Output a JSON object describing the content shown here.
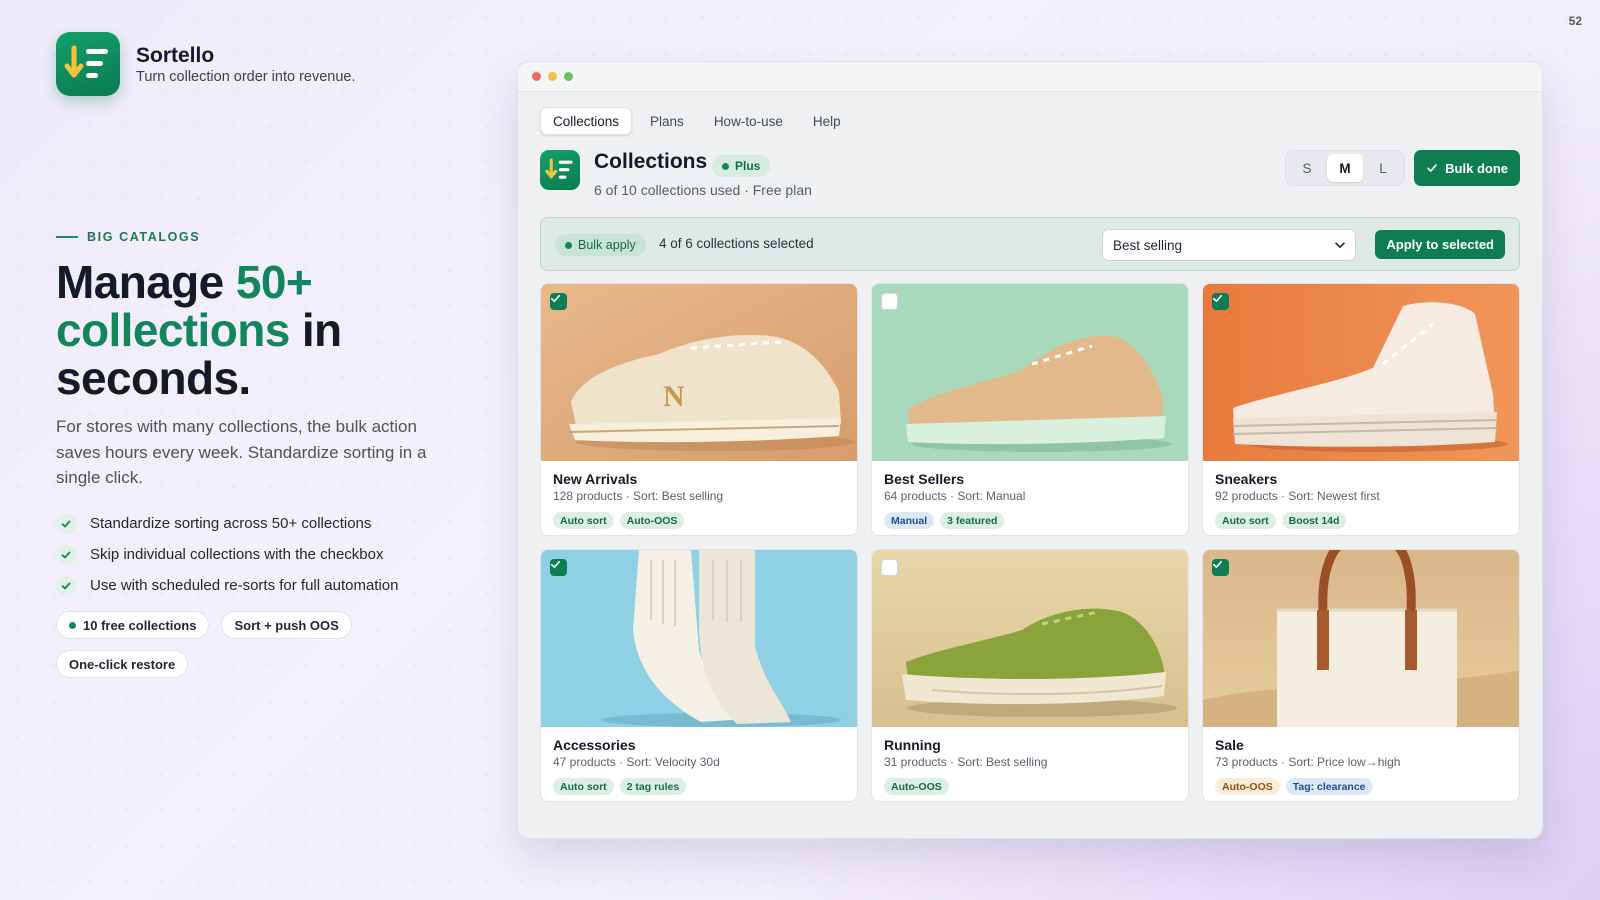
{
  "page_number": "52",
  "brand": {
    "name": "Sortello",
    "tagline": "Turn collection order into revenue."
  },
  "hero": {
    "eyebrow": "BIG CATALOGS",
    "headline_part1": "Manage ",
    "headline_accent": "50+ collections",
    "headline_part2": " in seconds.",
    "lede": "For stores with many collections, the bulk action saves hours every week. Standardize sorting in a single click.",
    "bullets": [
      "Standardize sorting across 50+ collections",
      "Skip individual collections with the checkbox",
      "Use with scheduled re-sorts for full automation"
    ],
    "chips": [
      "10 free collections",
      "Sort + push OOS",
      "One-click restore"
    ]
  },
  "app": {
    "tabs": [
      {
        "label": "Collections",
        "active": true
      },
      {
        "label": "Plans",
        "active": false
      },
      {
        "label": "How-to-use",
        "active": false
      },
      {
        "label": "Help",
        "active": false
      }
    ],
    "title": "Collections",
    "plan_badge": "Plus",
    "subtitle": "6 of 10 collections used · Free plan",
    "density": {
      "options": [
        "S",
        "M",
        "L"
      ],
      "selected": "M"
    },
    "bulk_done_label": "Bulk done",
    "bulk_bar": {
      "pill": "Bulk apply",
      "count": "4 of 6 collections selected",
      "sort_value": "Best selling",
      "apply_label": "Apply to selected"
    },
    "collections": [
      {
        "title": "New Arrivals",
        "meta": "128 products · Sort: Best selling",
        "checked": true,
        "image": "sneaker-low-cream",
        "tags": [
          {
            "label": "Auto sort",
            "color": "green"
          },
          {
            "label": "Auto-OOS",
            "color": "green"
          }
        ]
      },
      {
        "title": "Best Sellers",
        "meta": "64 products · Sort: Manual",
        "checked": false,
        "image": "sneaker-tan-mint",
        "tags": [
          {
            "label": "Manual",
            "color": "blue"
          },
          {
            "label": "3 featured",
            "color": "green"
          }
        ]
      },
      {
        "title": "Sneakers",
        "meta": "92 products · Sort: Newest first",
        "checked": true,
        "image": "sneaker-hightop-orange",
        "tags": [
          {
            "label": "Auto sort",
            "color": "green"
          },
          {
            "label": "Boost 14d",
            "color": "green"
          }
        ]
      },
      {
        "title": "Accessories",
        "meta": "47 products · Sort: Velocity 30d",
        "checked": true,
        "image": "socks-blue",
        "tags": [
          {
            "label": "Auto sort",
            "color": "green"
          },
          {
            "label": "2 tag rules",
            "color": "green"
          }
        ]
      },
      {
        "title": "Running",
        "meta": "31 products · Sort: Best selling",
        "checked": false,
        "image": "running-shoe-green",
        "tags": [
          {
            "label": "Auto-OOS",
            "color": "green"
          }
        ]
      },
      {
        "title": "Sale",
        "meta": "73 products · Sort: Price low→high",
        "checked": true,
        "image": "tote-bag-sand",
        "tags": [
          {
            "label": "Auto-OOS",
            "color": "amber"
          },
          {
            "label": "Tag: clearance",
            "color": "blue"
          }
        ]
      }
    ]
  },
  "colors": {
    "brand_green": "#0f7d52",
    "accent_text": "#13855a",
    "window_bg": "#eef0f2"
  }
}
